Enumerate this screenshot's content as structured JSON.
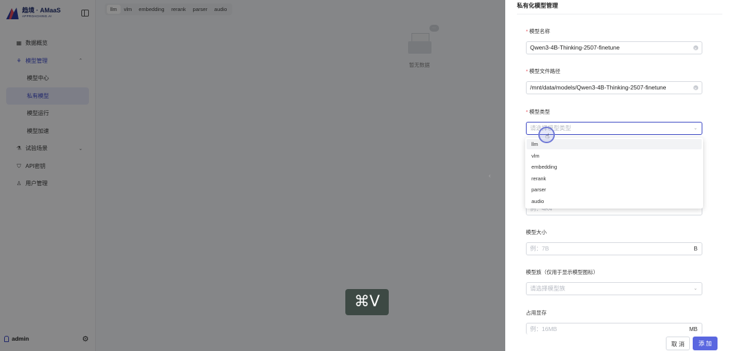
{
  "brand": {
    "title": "趋境 · AMaaS",
    "subtitle": "APPROACHING.AI"
  },
  "sidebar": {
    "items": [
      {
        "label": "数据概览",
        "icon": "grid-icon"
      },
      {
        "label": "模型管理",
        "icon": "model-icon"
      },
      {
        "label": "模型中心"
      },
      {
        "label": "私有模型"
      },
      {
        "label": "模型运行"
      },
      {
        "label": "模型加速"
      },
      {
        "label": "试验场景",
        "icon": "flask-icon"
      },
      {
        "label": "API密钥",
        "icon": "shield-icon"
      },
      {
        "label": "用户管理",
        "icon": "user-icon"
      }
    ],
    "user": "admin"
  },
  "tabs": [
    "llm",
    "vlm",
    "embedding",
    "rerank",
    "parser",
    "audio"
  ],
  "active_tab": "llm",
  "empty": {
    "text": "暂无数据",
    "bubble": "..."
  },
  "shortcut": "⌘V",
  "drawer": {
    "title": "私有化模型管理",
    "fields": {
      "name": {
        "label": "模型名称",
        "value": "Qwen3-4B-Thinking-2507-finetune"
      },
      "path": {
        "label": "模型文件路径",
        "value": "/mnt/data/models/Qwen3-4B-Thinking-2507-finetune"
      },
      "type": {
        "label": "模型类型",
        "placeholder": "请选择模型类型"
      },
      "hidden_placeholder": "例：4K4",
      "size": {
        "label": "模型大小",
        "placeholder": "例：7B",
        "suffix": "B"
      },
      "family": {
        "label": "模型族（仅用于显示模型图标）",
        "placeholder": "请选择模型族"
      },
      "memory": {
        "label": "占用显存",
        "placeholder": "例：16MB",
        "suffix": "MB"
      }
    },
    "type_options": [
      "llm",
      "vlm",
      "embedding",
      "rerank",
      "parser",
      "audio"
    ],
    "buttons": {
      "cancel": "取 消",
      "add": "添 加"
    }
  }
}
